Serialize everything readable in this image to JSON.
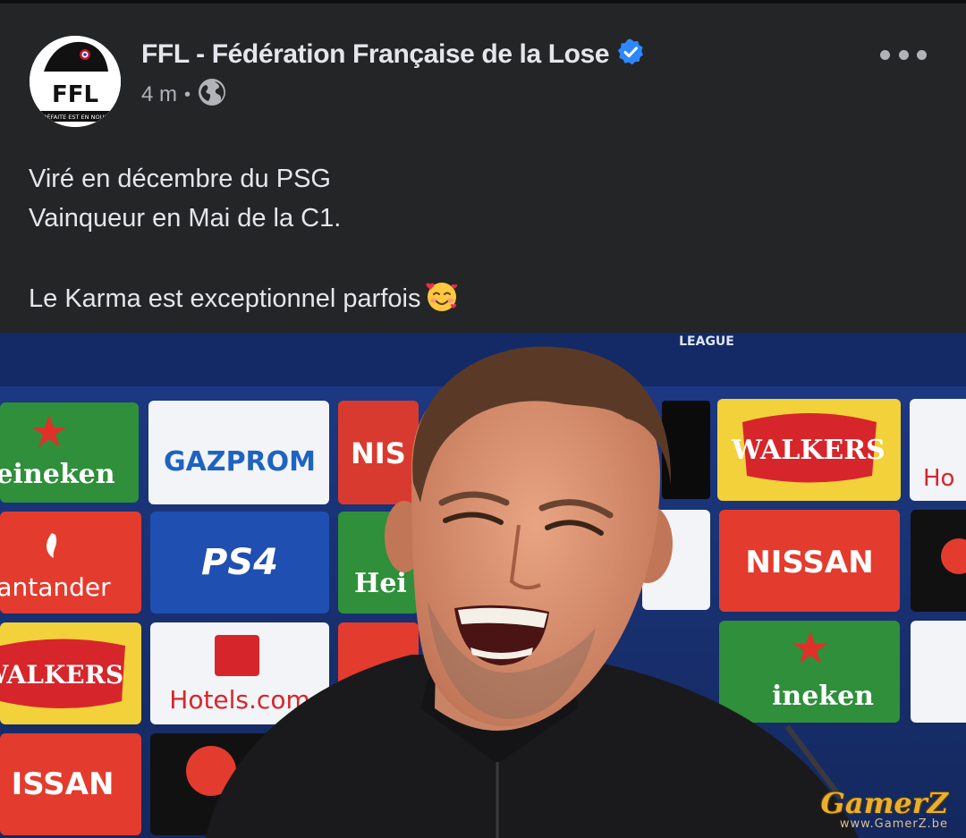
{
  "post": {
    "page_name": "FFL - Fédération Française de la Lose",
    "timestamp": "4 m",
    "separator": "•",
    "audience_icon": "globe-icon",
    "verified_icon": "verified-badge-icon",
    "more_icon": "more-options-icon",
    "avatar": {
      "initials": "FFL",
      "tagline": "DÉFAITE EST EN NOUS"
    },
    "caption": {
      "line1": "Viré en décembre du PSG",
      "line2": "Vainqueur en Mai de la C1.",
      "line3": "Le Karma est exceptionnel parfois",
      "emoji": "smiling-face-with-hearts-emoji"
    }
  },
  "photo": {
    "board_text": {
      "league": "LEAGUE",
      "heineken": "eineken",
      "gazprom": "GAZPROM",
      "nissan_partial": "NIS",
      "walkers": "WALKERS",
      "hotels_partial": "Ho",
      "santander": "antander",
      "ps4": "PS4",
      "heineken_partial": "Hei",
      "nissan": "NISSAN",
      "walkers_partial": "WALKERS",
      "hotels": "Hotels.com",
      "heineken_right": "ineken",
      "nissan_bottom": "ISSAN"
    }
  },
  "watermark": {
    "title": "GamerZ",
    "url": "www.GamerZ.be"
  },
  "colors": {
    "background": "#242526",
    "text": "#e4e6eb",
    "secondary": "#b0b3b8",
    "verified": "#2d88ff"
  }
}
